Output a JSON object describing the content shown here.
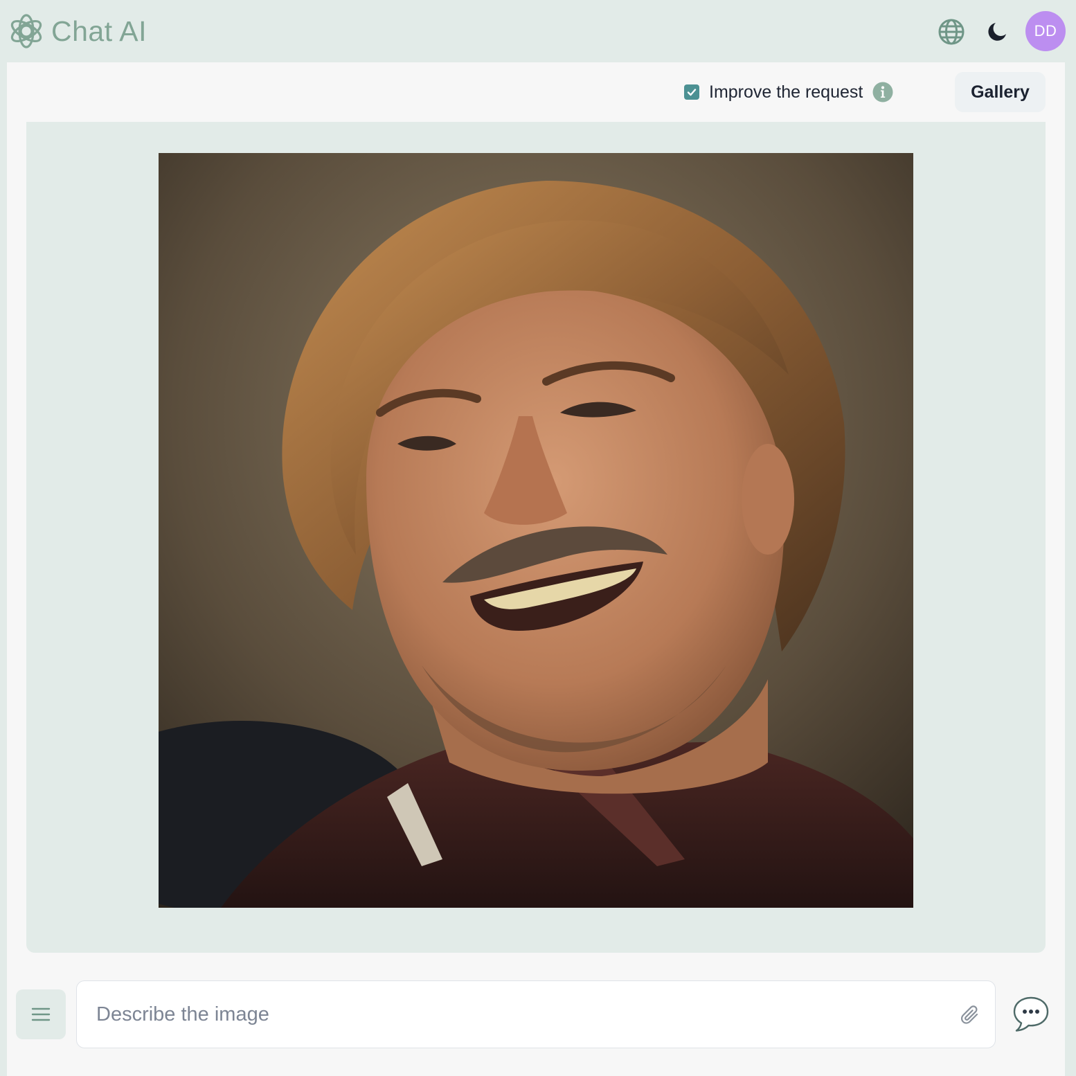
{
  "header": {
    "app_name": "Chat AI",
    "logo_icon": "openai-knot-icon",
    "language_icon": "globe-icon",
    "theme_icon": "moon-icon",
    "avatar_initials": "DD"
  },
  "toolbar": {
    "improve_label": "Improve the request",
    "improve_checked": true,
    "info_icon": "info-icon",
    "gallery_label": "Gallery"
  },
  "result": {
    "image_icon": "generated-portrait-image"
  },
  "composer": {
    "placeholder": "Describe the image",
    "value": "",
    "menu_icon": "hamburger-menu-icon",
    "attach_icon": "paperclip-icon",
    "chat_icon": "chat-bubble-icon"
  },
  "colors": {
    "accent": "#82a595",
    "checkbox": "#4c9193",
    "avatar": "#bc8ef0",
    "header_bg": "#e2ebe8",
    "panel_bg": "#f7f7f7"
  }
}
